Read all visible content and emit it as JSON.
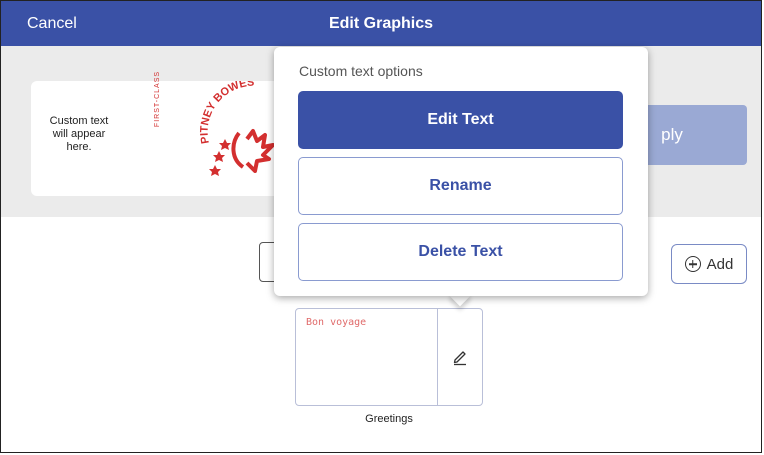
{
  "header": {
    "cancel_label": "Cancel",
    "title": "Edit Graphics"
  },
  "preview": {
    "custom_text": "Custom text will appear here.",
    "class_label": "FIRST-CLASS",
    "stamp_text": "PITNEY BOWES"
  },
  "apply_label": "ply",
  "add_label": "Add",
  "tile": {
    "text": "Bon voyage",
    "label": "Greetings"
  },
  "popover": {
    "title": "Custom text options",
    "options": [
      {
        "label": "Edit Text"
      },
      {
        "label": "Rename"
      },
      {
        "label": "Delete Text"
      }
    ]
  },
  "colors": {
    "primary": "#3a51a6",
    "stamp_red": "#d32f2f"
  }
}
